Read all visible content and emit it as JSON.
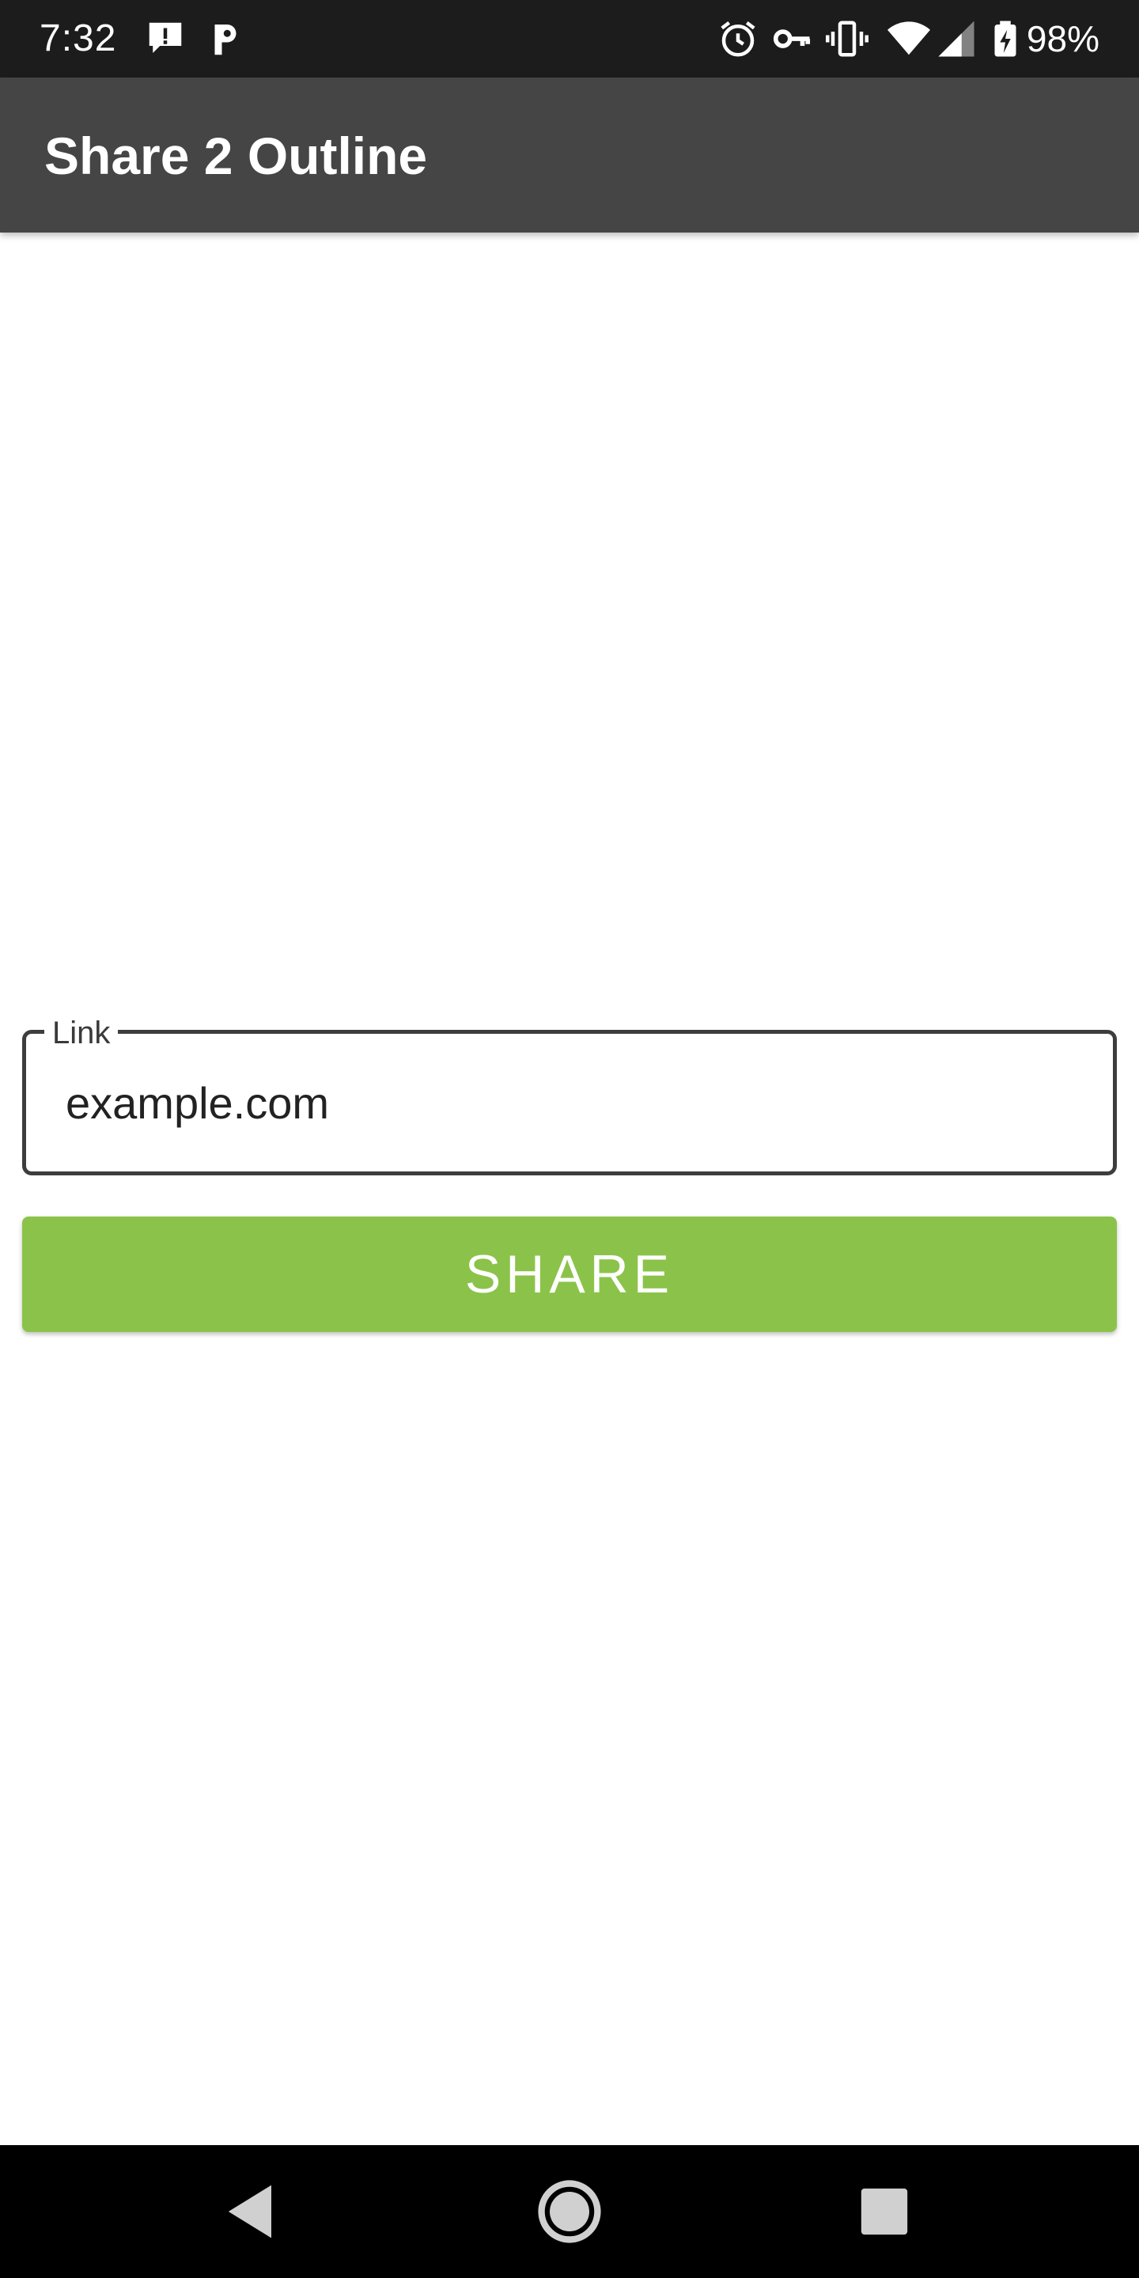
{
  "status_bar": {
    "time": "7:32",
    "battery_percent": "98%",
    "icons": [
      "alert-notification-icon",
      "parking-app-icon",
      "alarm-icon",
      "vpn-key-icon",
      "vibrate-icon",
      "wifi-icon",
      "cell-signal-icon",
      "battery-charging-icon"
    ]
  },
  "app_bar": {
    "title": "Share 2 Outline"
  },
  "form": {
    "link_label": "Link",
    "link_value": "example.com",
    "share_label": "SHARE"
  },
  "nav_bar": {
    "icons": [
      "back-icon",
      "home-icon",
      "recents-icon"
    ]
  },
  "colors": {
    "status_bar_bg": "#1c1c1c",
    "app_bar_bg": "#454545",
    "accent": "#8bc34a",
    "nav_bar_bg": "#000000"
  }
}
